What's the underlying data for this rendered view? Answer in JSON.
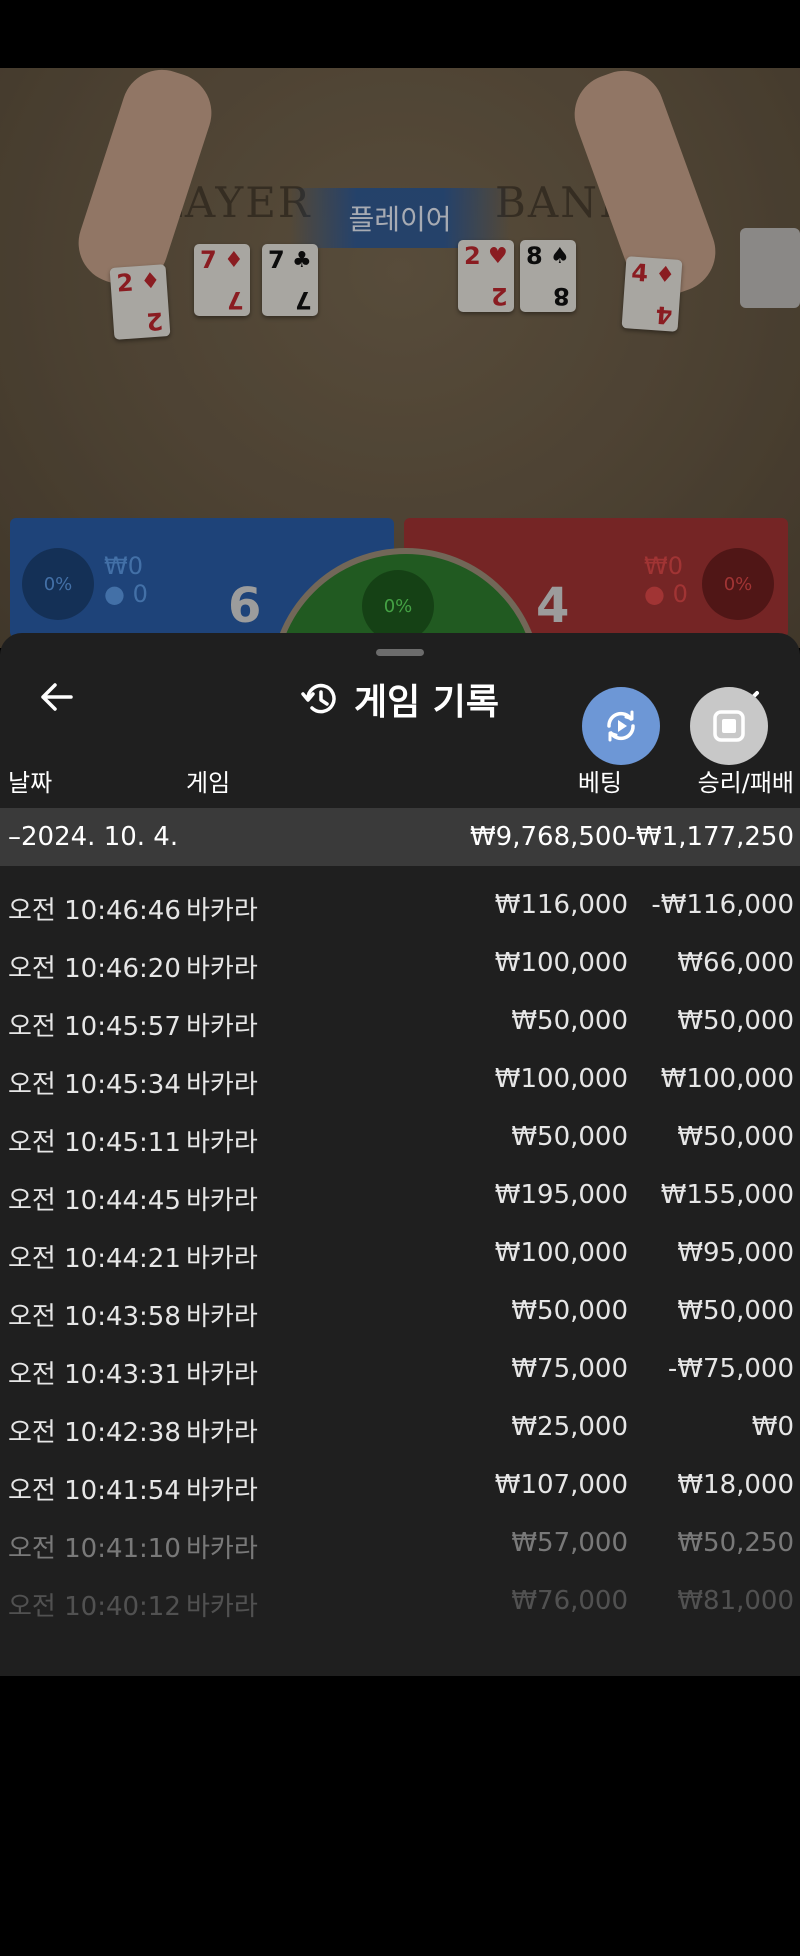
{
  "table": {
    "felt_player_text": "LAYER",
    "felt_banker_text": "BANKE",
    "banner_label": "플레이어",
    "player_cards": [
      {
        "rank": "2",
        "suit": "♦",
        "color": "red"
      },
      {
        "rank": "7",
        "suit": "♦",
        "color": "red"
      },
      {
        "rank": "7",
        "suit": "♣",
        "color": "black"
      }
    ],
    "banker_cards": [
      {
        "rank": "2",
        "suit": "♥",
        "color": "red"
      },
      {
        "rank": "8",
        "suit": "♠",
        "color": "black"
      },
      {
        "rank": "4",
        "suit": "♦",
        "color": "red"
      }
    ],
    "player_panel": {
      "percent": "0%",
      "amount": "₩0",
      "count": "0",
      "score": "6"
    },
    "banker_panel": {
      "percent": "0%",
      "amount": "₩0",
      "count": "0",
      "score": "4"
    },
    "tie_percent": "0%"
  },
  "sheet": {
    "title": "게임 기록",
    "columns": {
      "date": "날짜",
      "game": "게임",
      "bet": "베팅",
      "win_loss": "승리/패배"
    },
    "summary": {
      "date": "–2024. 10. 4.",
      "bet": "₩9,768,500",
      "win_loss": "-₩1,177,250"
    },
    "rows": [
      {
        "time": "오전 10:46:46",
        "game": "바카라",
        "bet": "₩116,000",
        "win_loss": "-₩116,000"
      },
      {
        "time": "오전 10:46:20",
        "game": "바카라",
        "bet": "₩100,000",
        "win_loss": "₩66,000"
      },
      {
        "time": "오전 10:45:57",
        "game": "바카라",
        "bet": "₩50,000",
        "win_loss": "₩50,000"
      },
      {
        "time": "오전 10:45:34",
        "game": "바카라",
        "bet": "₩100,000",
        "win_loss": "₩100,000"
      },
      {
        "time": "오전 10:45:11",
        "game": "바카라",
        "bet": "₩50,000",
        "win_loss": "₩50,000"
      },
      {
        "time": "오전 10:44:45",
        "game": "바카라",
        "bet": "₩195,000",
        "win_loss": "₩155,000"
      },
      {
        "time": "오전 10:44:21",
        "game": "바카라",
        "bet": "₩100,000",
        "win_loss": "₩95,000"
      },
      {
        "time": "오전 10:43:58",
        "game": "바카라",
        "bet": "₩50,000",
        "win_loss": "₩50,000"
      },
      {
        "time": "오전 10:43:31",
        "game": "바카라",
        "bet": "₩75,000",
        "win_loss": "-₩75,000"
      },
      {
        "time": "오전 10:42:38",
        "game": "바카라",
        "bet": "₩25,000",
        "win_loss": "₩0"
      },
      {
        "time": "오전 10:41:54",
        "game": "바카라",
        "bet": "₩107,000",
        "win_loss": "₩18,000"
      },
      {
        "time": "오전 10:41:10",
        "game": "바카라",
        "bet": "₩57,000",
        "win_loss": "₩50,250"
      },
      {
        "time": "오전 10:40:12",
        "game": "바카라",
        "bet": "₩76,000",
        "win_loss": "₩81,000"
      }
    ]
  },
  "icons": {
    "back": "arrow-left-icon",
    "history": "history-icon",
    "close": "chevron-down-icon",
    "replay": "replay-icon",
    "stop": "stop-icon"
  },
  "colors": {
    "player_blue": "#2a5ea8",
    "banker_red": "#a23434",
    "tie_green": "#2f7d2f",
    "sheet_bg": "#1f1f1f",
    "summary_bg": "#3a3a3a",
    "replay_fab": "#6d97d6",
    "stop_fab": "#c8c8c8"
  }
}
